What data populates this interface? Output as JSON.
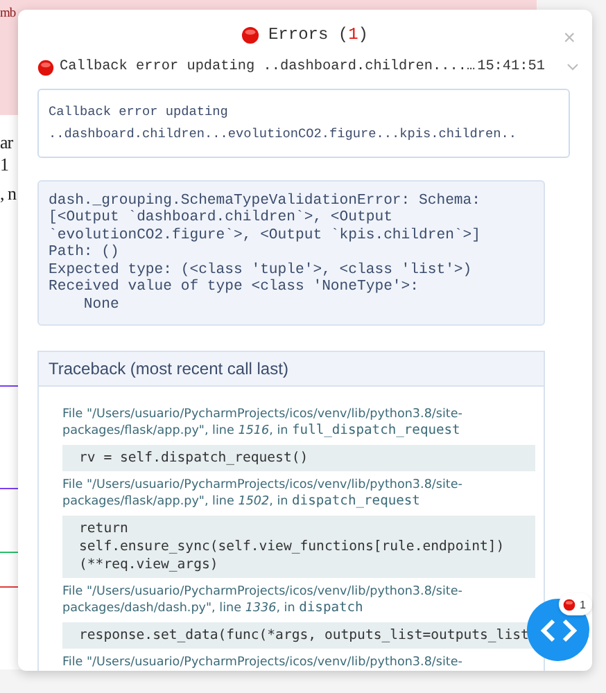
{
  "background": {
    "texts": [
      "mb",
      "ar",
      "1",
      ", n"
    ]
  },
  "modal": {
    "title": "Errors (",
    "count": "1",
    "title_end": ")",
    "error": {
      "summary": "Callback error updating ..dashboard.children....…",
      "time": "15:41:51",
      "expanded": true,
      "message": [
        "Callback error updating",
        "..dashboard.children...evolutionCO2.figure...kpis.children.."
      ],
      "details": [
        "dash._grouping.SchemaTypeValidationError: Schema:",
        "[<Output `dashboard.children`>, <Output",
        "`evolutionCO2.figure`>, <Output `kpis.children`>]",
        "Path: ()",
        "Expected type: (<class 'tuple'>, <class 'list'>)",
        "Received value of type <class 'NoneType'>:",
        "    None"
      ],
      "traceback": {
        "title": "Traceback (most recent call last)",
        "frames": [
          {
            "file": "File \"/Users/usuario/PycharmProjects/icos/venv/lib/python3.8/site-packages/flask/app.py\", line ",
            "line": "1516",
            "in": ", in ",
            "function": "full_dispatch_request",
            "code": [
              "rv = self.dispatch_request()"
            ]
          },
          {
            "file": "File \"/Users/usuario/PycharmProjects/icos/venv/lib/python3.8/site-packages/flask/app.py\", line ",
            "line": "1502",
            "in": ", in ",
            "function": "dispatch_request",
            "code": [
              "return",
              "self.ensure_sync(self.view_functions[rule.endpoint])",
              "(**req.view_args)"
            ]
          },
          {
            "file": "File \"/Users/usuario/PycharmProjects/icos/venv/lib/python3.8/site-packages/dash/dash.py\", line ",
            "line": "1336",
            "in": ", in ",
            "function": "dispatch",
            "code": [
              "response.set_data(func(*args, outputs_list=outputs_list"
            ]
          },
          {
            "file": "File \"/Users/usuario/PycharmProjects/icos/venv/lib/python3.8/site-"
          }
        ]
      }
    },
    "close": "×"
  },
  "debug_button": {
    "badge": "1"
  }
}
